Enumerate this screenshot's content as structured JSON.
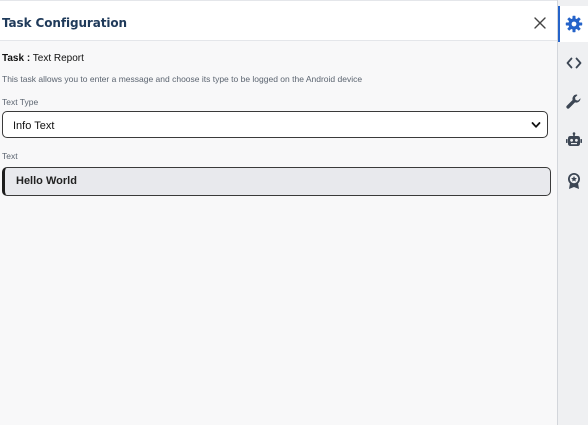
{
  "panel": {
    "title": "Task Configuration",
    "task_label": "Task :",
    "task_name": "Text Report",
    "description": "This task allows you to enter a message and choose its type to be logged on the Android device"
  },
  "fields": {
    "text_type": {
      "label": "Text Type",
      "value": "Info Text"
    },
    "text": {
      "label": "Text",
      "value": "Hello World"
    }
  },
  "sidebar": {
    "items": [
      {
        "icon": "gear-icon",
        "active": true
      },
      {
        "icon": "code-icon",
        "active": false
      },
      {
        "icon": "wrench-icon",
        "active": false
      },
      {
        "icon": "robot-icon",
        "active": false
      },
      {
        "icon": "award-icon",
        "active": false
      }
    ]
  },
  "colors": {
    "accent": "#2563c9",
    "title": "#1f3a5a",
    "icon": "#3c4654"
  }
}
